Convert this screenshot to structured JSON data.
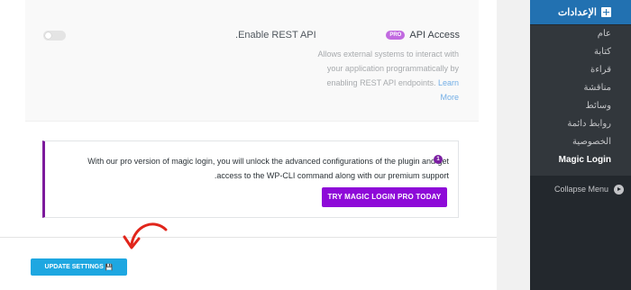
{
  "api_card": {
    "title": "API Access",
    "badge": "PRO",
    "description": "Allows external systems to interact with your application programmatically by enabling REST API endpoints.",
    "learn_more": "Learn More",
    "rest_label": "Enable REST API.",
    "toggle_on": false
  },
  "promo": {
    "text": "With our pro version of magic login, you will unlock the advanced configurations of the plugin and get access to the WP-CLI command along with our premium support.",
    "badge": "1",
    "button_label": "TRY MAGIC LOGIN PRO TODAY"
  },
  "footer": {
    "update_label": "UPDATE SETTINGS",
    "update_icon": "save-disk-icon"
  },
  "sidebar": {
    "settings_label": "الإعدادات",
    "items": [
      {
        "label": "عام"
      },
      {
        "label": "كتابة"
      },
      {
        "label": "قراءة"
      },
      {
        "label": "مناقشة"
      },
      {
        "label": "وسائط"
      },
      {
        "label": "روابط دائمة"
      },
      {
        "label": "الخصوصية"
      },
      {
        "label": "Magic Login"
      }
    ],
    "collapse_label": "Collapse Menu"
  },
  "colors": {
    "accent": "#8e0ad8",
    "update_button": "#1ea7e1",
    "sidebar_active": "#2271b1",
    "sidebar_bg": "#23282d"
  }
}
